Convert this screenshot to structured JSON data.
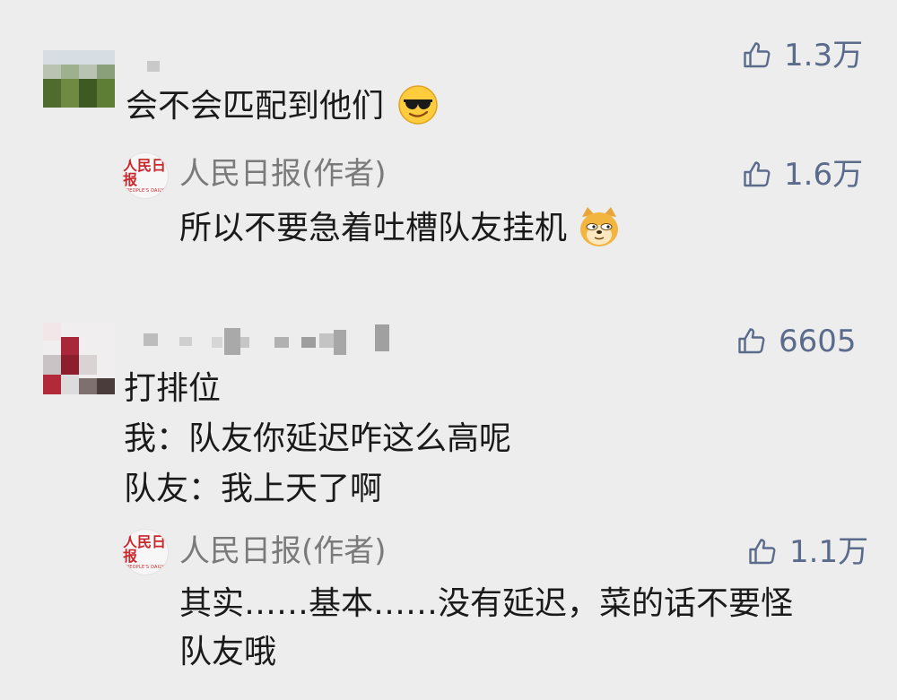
{
  "comments": [
    {
      "text": "会不会匹配到他们",
      "likes": "1.3万",
      "emoji": "sunglasses-emoji",
      "reply": {
        "author": "人民日报(作者)",
        "text": "所以不要急着吐槽队友挂机",
        "likes": "1.6万",
        "emoji": "doge-emoji"
      }
    },
    {
      "lines": [
        "打排位",
        "我：队友你延迟咋这么高呢",
        "队友：我上天了啊"
      ],
      "likes": "6605",
      "reply": {
        "author": "人民日报(作者)",
        "lines": [
          "其实……基本……没有延迟，菜的话不要怪",
          "队友哦"
        ],
        "likes": "1.1万"
      }
    }
  ],
  "logo": {
    "cn": "人民日报",
    "en": "PEOPLE'S DAILY"
  },
  "colors": {
    "background": "#ededed",
    "like": "#5a6b8c",
    "author": "#7a7a7a",
    "logo_red": "#c8282d"
  }
}
